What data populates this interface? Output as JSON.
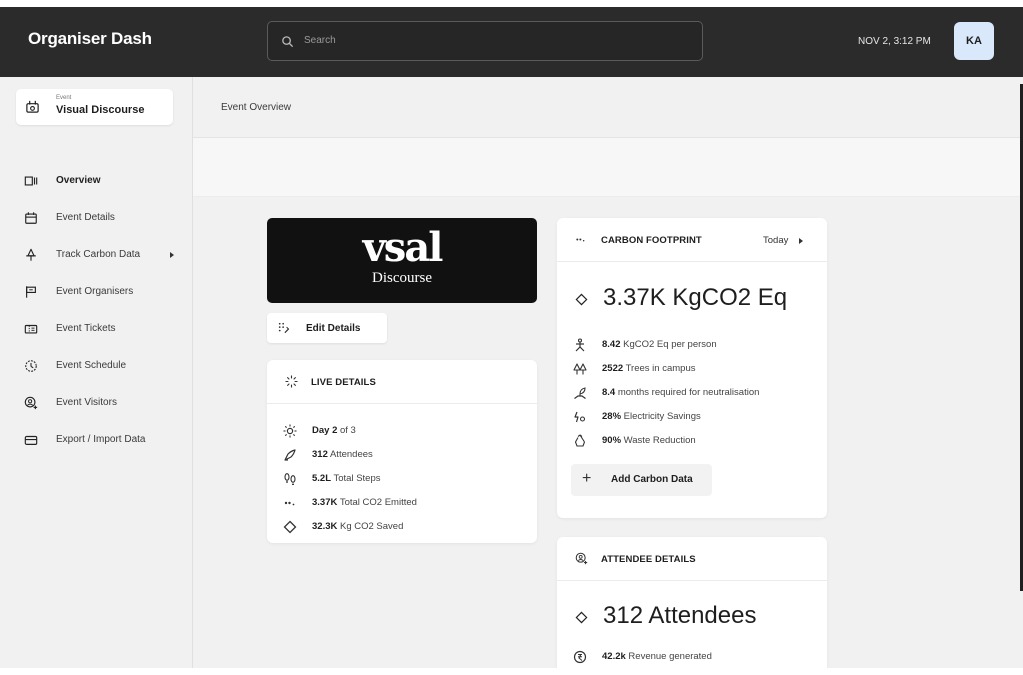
{
  "app": {
    "title": "Organiser Dash",
    "search_placeholder": "Search",
    "datetime": "NOV 2, 3:12 PM",
    "avatar_initials": "KA"
  },
  "event": {
    "small_label": "Event",
    "name": "Visual Discourse"
  },
  "sidebar": {
    "items": [
      {
        "label": "Overview",
        "icon": "overview-icon"
      },
      {
        "label": "Event Details",
        "icon": "calendar-icon"
      },
      {
        "label": "Track Carbon Data",
        "icon": "carbon-track-icon"
      },
      {
        "label": "Event Organisers",
        "icon": "flag-icon"
      },
      {
        "label": "Event Tickets",
        "icon": "ticket-icon"
      },
      {
        "label": "Event Schedule",
        "icon": "clock-icon"
      },
      {
        "label": "Event Visitors",
        "icon": "visitors-icon"
      },
      {
        "label": "Export / Import Data",
        "icon": "export-icon"
      }
    ]
  },
  "breadcrumb": "Event Overview",
  "logo": {
    "word": "vsal",
    "sub": "Discourse"
  },
  "edit_details_label": "Edit Details",
  "live": {
    "title": "LIVE DETAILS",
    "rows": [
      {
        "bold": "Day 2",
        "rest": " of 3"
      },
      {
        "bold": "312",
        "rest": " Attendees"
      },
      {
        "bold": "5.2L",
        "rest": " Total Steps"
      },
      {
        "bold": "3.37K",
        "rest": " Total CO2 Emitted"
      },
      {
        "bold": "32.3K",
        "rest": " Kg CO2 Saved"
      }
    ]
  },
  "carbon": {
    "title": "CARBON FOOTPRINT",
    "period": "Today",
    "headline": "3.37K KgCO2 Eq",
    "rows": [
      {
        "bold": "8.42",
        "rest": " KgCO2 Eq per person"
      },
      {
        "bold": "2522",
        "rest": " Trees in campus"
      },
      {
        "bold": "8.4",
        "rest": " months required for neutralisation"
      },
      {
        "bold": "28%",
        "rest": " Electricity Savings"
      },
      {
        "bold": "90%",
        "rest": " Waste Reduction"
      }
    ],
    "add_label": "Add Carbon Data"
  },
  "attendee": {
    "title": "ATTENDEE DETAILS",
    "headline": "312 Attendees",
    "rows": [
      {
        "bold": "42.2k",
        "rest": " Revenue generated"
      }
    ]
  },
  "colors": {
    "topbar": "#2b2b2b",
    "avatar_bg": "#d9e9fb",
    "page_bg": "#f1f1f1",
    "card_bg": "#ffffff"
  }
}
